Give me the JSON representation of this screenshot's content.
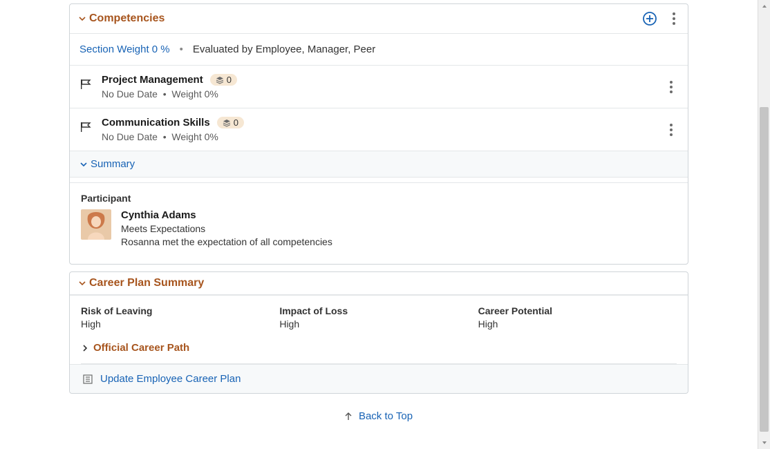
{
  "competencies": {
    "title": "Competencies",
    "section_weight_label": "Section Weight 0 %",
    "evaluated_by": "Evaluated by Employee, Manager, Peer",
    "items": [
      {
        "title": "Project Management",
        "badge_count": "0",
        "due": "No Due Date",
        "weight": "Weight 0%"
      },
      {
        "title": "Communication Skills",
        "badge_count": "0",
        "due": "No Due Date",
        "weight": "Weight 0%"
      }
    ],
    "summary_label": "Summary",
    "participant_label": "Participant",
    "participant": {
      "name": "Cynthia Adams",
      "rating": "Meets Expectations",
      "comment": "Rosanna met the expectation of all competencies"
    }
  },
  "career": {
    "title": "Career Plan Summary",
    "metrics": {
      "risk_label": "Risk of Leaving",
      "risk_value": "High",
      "impact_label": "Impact of Loss",
      "impact_value": "High",
      "potential_label": "Career Potential",
      "potential_value": "High"
    },
    "official_path_label": "Official Career Path",
    "update_link": "Update Employee Career Plan"
  },
  "back_to_top": "Back to Top"
}
